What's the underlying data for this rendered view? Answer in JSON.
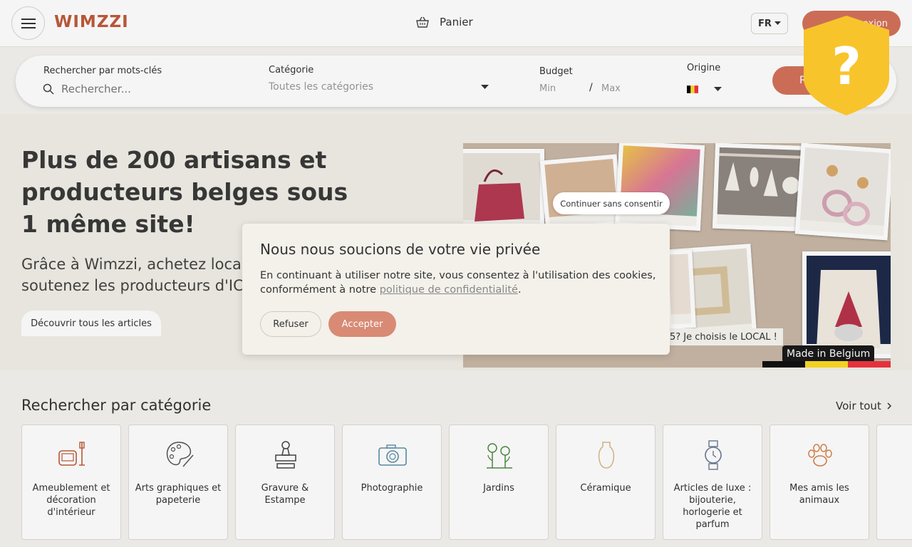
{
  "header": {
    "logo": "WIMZZI",
    "cart_label": "Panier",
    "language": "FR",
    "connect_label": "Connexion",
    "brand_color": "#c05a3a",
    "accent_color": "#d4725a"
  },
  "search": {
    "keywords_label": "Rechercher par mots-clés",
    "keywords_placeholder": "Rechercher...",
    "category_label": "Catégorie",
    "category_value": "Toutes les catégories",
    "budget_label": "Budget",
    "budget_min": "Min",
    "budget_sep": "/",
    "budget_max": "Max",
    "origin_label": "Origine",
    "submit_label": "R"
  },
  "hero": {
    "title": "Plus de 200 artisans et producteurs belges sous 1 même site!",
    "subtitle": "Grâce à Wimzzi, achetez local et soutenez les producteurs d'ICI",
    "discover_label": "Découvrir tous les articles",
    "collage_caption": "5? Je choisis le LOCAL !",
    "made_in_label": "Made in Belgium"
  },
  "categories": {
    "title": "Rechercher par catégorie",
    "see_all": "Voir tout",
    "items": [
      {
        "label": "Ameublement et décoration d'intérieur",
        "icon": "armchair-lamp-icon"
      },
      {
        "label": "Arts graphiques et papeterie",
        "icon": "palette-icon"
      },
      {
        "label": "Gravure & Estampe",
        "icon": "stamp-icon"
      },
      {
        "label": "Photographie",
        "icon": "camera-icon"
      },
      {
        "label": "Jardins",
        "icon": "flowers-icon"
      },
      {
        "label": "Céramique",
        "icon": "vase-icon"
      },
      {
        "label": "Articles de luxe : bijouterie, horlogerie et parfum",
        "icon": "watch-icon"
      },
      {
        "label": "Mes amis les animaux",
        "icon": "paw-icon"
      }
    ]
  },
  "consent": {
    "title": "Nous nous soucions de votre vie privée",
    "text_before": "En continuant à utiliser notre site, vous consentez à l'utilisation des cookies, conformément à notre ",
    "link_label": "politique de confidentialité",
    "text_after": ".",
    "refuse_label": "Refuser",
    "accept_label": "Accepter",
    "continue_label": "Continuer sans consentir"
  },
  "badge": {
    "symbol": "?",
    "color": "#f8c42c"
  }
}
